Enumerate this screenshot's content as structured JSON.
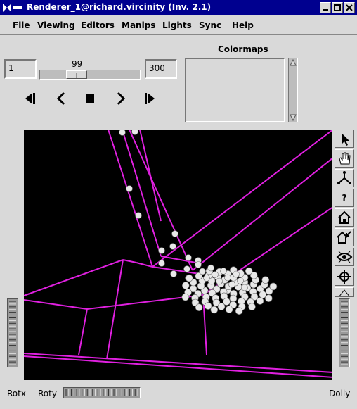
{
  "window": {
    "title": "Renderer_1@richard.vircinity  (Inv. 2.1)"
  },
  "menubar": {
    "items": [
      "File",
      "Viewing",
      "Editors",
      "Manips",
      "Lights",
      "Sync",
      "Help"
    ]
  },
  "frames": {
    "start": "1",
    "current": "99",
    "end": "300"
  },
  "colormaps": {
    "label": "Colormaps"
  },
  "viewer": {
    "rotx_label": "Rotx",
    "roty_label": "Roty",
    "dolly_label": "Dolly",
    "tools": [
      "pick-arrow-icon",
      "hand-icon",
      "viewpoint-icon",
      "help-question-icon",
      "home-icon",
      "set-home-icon",
      "view-all-eye-icon",
      "seek-icon",
      "perspective-icon"
    ],
    "help_glyph": "?",
    "line_color": "#e020e0",
    "sphere_color": "#e8e8e8"
  }
}
